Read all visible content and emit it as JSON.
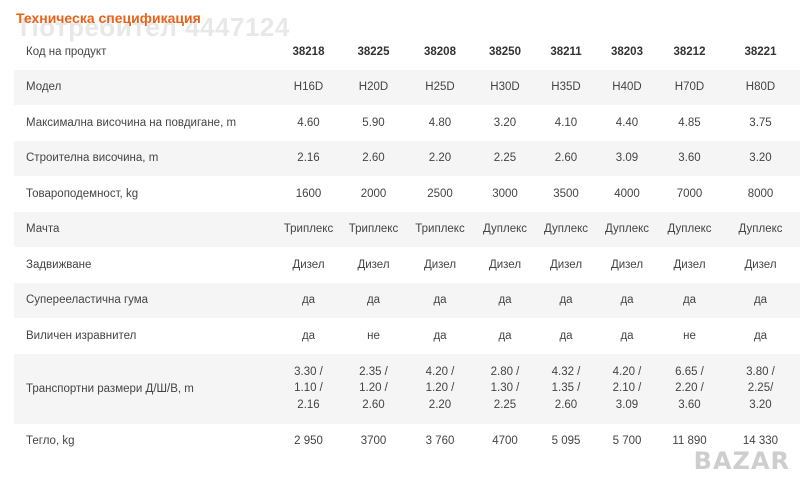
{
  "title": "Техническа спецификация",
  "watermark": "Потребител 4447124",
  "logo_text": "BAZAR",
  "columns_label": "Код на продукт",
  "columns": [
    "38218",
    "38225",
    "38208",
    "38250",
    "38211",
    "38203",
    "38212",
    "38221"
  ],
  "rows": [
    {
      "label": "Модел",
      "values": [
        "H16D",
        "H20D",
        "H25D",
        "H30D",
        "H35D",
        "H40D",
        "H70D",
        "H80D"
      ]
    },
    {
      "label": "Максимална височина на повдигане, m",
      "values": [
        "4.60",
        "5.90",
        "4.80",
        "3.20",
        "4.10",
        "4.40",
        "4.85",
        "3.75"
      ]
    },
    {
      "label": "Строителна височина, m",
      "values": [
        "2.16",
        "2.60",
        "2.20",
        "2.25",
        "2.60",
        "3.09",
        "3.60",
        "3.20"
      ]
    },
    {
      "label": "Товароподемност, kg",
      "values": [
        "1600",
        "2000",
        "2500",
        "3000",
        "3500",
        "4000",
        "7000",
        "8000"
      ]
    },
    {
      "label": "Мачта",
      "values": [
        "Триплекс",
        "Триплекс",
        "Триплекс",
        "Дуплекс",
        "Дуплекс",
        "Дуплекс",
        "Дуплекс",
        "Дуплекс"
      ]
    },
    {
      "label": "Задвижване",
      "values": [
        "Дизел",
        "Дизел",
        "Дизел",
        "Дизел",
        "Дизел",
        "Дизел",
        "Дизел",
        "Дизел"
      ]
    },
    {
      "label": "Суперееластична гума",
      "values": [
        "да",
        "да",
        "да",
        "да",
        "да",
        "да",
        "да",
        "да"
      ]
    },
    {
      "label": "Виличен изравнител",
      "values": [
        "да",
        "не",
        "да",
        "да",
        "да",
        "да",
        "не",
        "да"
      ]
    },
    {
      "label": "Транспортни размери Д/Ш/В, m",
      "values": [
        [
          "3.30 /",
          "1.10 /",
          "2.16"
        ],
        [
          "2.35 /",
          "1.20 /",
          "2.60"
        ],
        [
          "4.20 /",
          "1.20 /",
          "2.20"
        ],
        [
          "2.80 /",
          "1.30 /",
          "2.25"
        ],
        [
          "4.32 /",
          "1.35 /",
          "2.60"
        ],
        [
          "4.20 /",
          "2.10 /",
          "3.09"
        ],
        [
          "6.65 /",
          "2.20 /",
          "3.60"
        ],
        [
          "3.80 /",
          "2.25/",
          "3.20"
        ]
      ]
    },
    {
      "label": "Тегло, kg",
      "values": [
        "2 950",
        "3700",
        "3 760",
        "4700",
        "5 095",
        "5 700",
        "11 890",
        "14 330"
      ]
    }
  ],
  "colors": {
    "title": "#e8621a",
    "band": "#f5f5f5",
    "text": "#444444"
  }
}
